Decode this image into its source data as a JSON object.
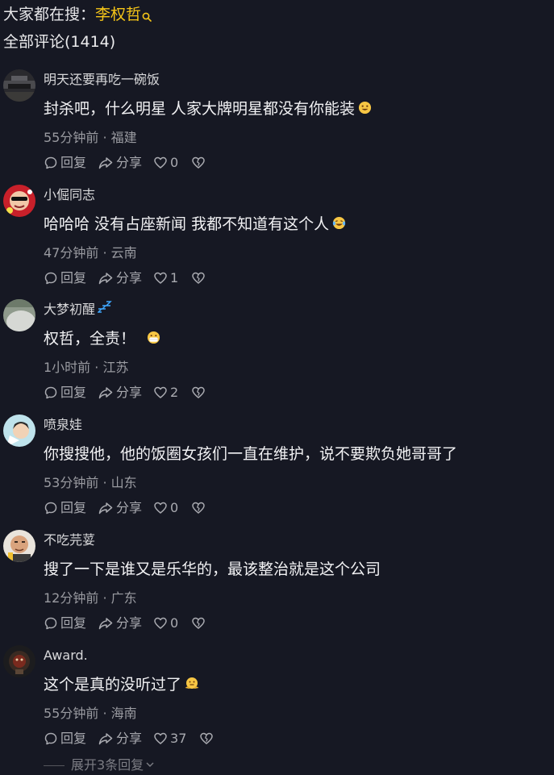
{
  "header": {
    "search_prefix": "大家都在搜：",
    "search_keyword": "李权哲",
    "comment_count_title": "全部评论(1414)"
  },
  "colors": {
    "background": "#161823",
    "keyword": "#f5c518",
    "meta_text": "#9a9ba1"
  },
  "actions": {
    "reply_label": "回复",
    "share_label": "分享"
  },
  "comments": [
    {
      "username": "明天还要再吃一碗饭",
      "content": "封杀吧，什么明星 人家大牌明星都没有你能装",
      "emoji": "grinning-emoji",
      "time": "55分钟前",
      "location": "福建",
      "likes": "0"
    },
    {
      "username": "小倔同志",
      "content": "哈哈哈 没有占座新闻 我都不知道有这个人",
      "emoji": "laughing-tears-emoji",
      "time": "47分钟前",
      "location": "云南",
      "likes": "1"
    },
    {
      "username": "大梦初醒",
      "username_badge": "zzz-sleep-icon",
      "content": "权哲，全责！",
      "emoji": "mask-face-emoji",
      "time": "1小时前",
      "location": "江苏",
      "likes": "2"
    },
    {
      "username": "喷泉娃",
      "content": "你搜搜他，他的饭圈女孩们一直在维护，说不要欺负她哥哥了",
      "time": "53分钟前",
      "location": "山东",
      "likes": "0"
    },
    {
      "username": "不吃芫荽",
      "content": "搜了一下是谁又是乐华的，最该整治就是这个公司",
      "time": "12分钟前",
      "location": "广东",
      "likes": "0"
    },
    {
      "username": "Award.",
      "content": "这个是真的没听过了",
      "emoji": "shrug-face-emoji",
      "time": "55分钟前",
      "location": "海南",
      "likes": "37"
    }
  ],
  "expand_replies_label": "展开3条回复"
}
